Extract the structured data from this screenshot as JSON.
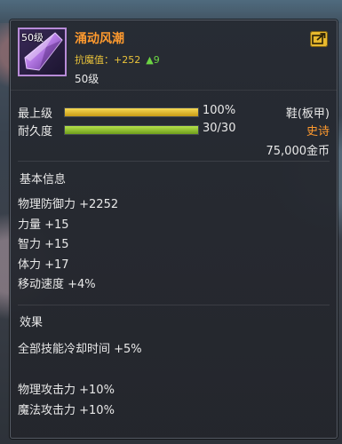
{
  "item": {
    "name": "涌动风潮",
    "icon_badge": "50级",
    "icon": "crystal-shard-icon",
    "resist_label": "抗魔值：",
    "resist_value": "+252",
    "resist_arrow": "▲",
    "resist_delta": "9",
    "level_text": "50级",
    "share_icon": "share-icon"
  },
  "bars": {
    "upgrade": {
      "label": "最上级",
      "value_text": "100%",
      "fraction": 1.0
    },
    "durability": {
      "label": "耐久度",
      "value_text": "30/30",
      "fraction": 1.0
    }
  },
  "meta": {
    "slot": "鞋(板甲)",
    "rarity": "史诗",
    "price": "75,000金币"
  },
  "basic_info": {
    "title": "基本信息",
    "stats": [
      "物理防御力 +2252",
      "力量 +15",
      "智力 +15",
      "体力 +17",
      "移动速度 +4%"
    ]
  },
  "effects": {
    "title": "效果",
    "line1": "全部技能冷却时间 +5%",
    "line2": "物理攻击力 +10%",
    "line3": "魔法攻击力 +10%"
  },
  "colors": {
    "name": "#ff9a2e",
    "rarity": "#ff9a2e",
    "resist": "#e9c23a",
    "increase": "#6cd444"
  }
}
